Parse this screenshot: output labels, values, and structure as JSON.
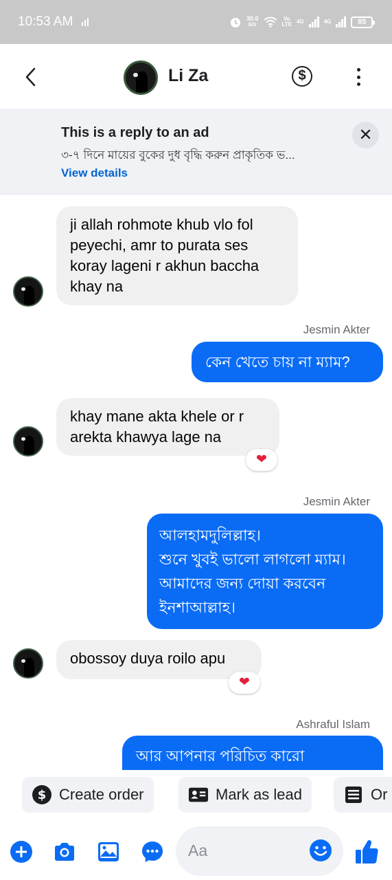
{
  "status_bar": {
    "time": "10:53 AM",
    "speed_value": "30.0",
    "speed_unit": "B/S",
    "volte_top": "Vo",
    "volte_bottom": "LTE",
    "net1": "4G",
    "net2": "4G",
    "battery": "85"
  },
  "header": {
    "contact_name": "Li Za",
    "back_icon": "chevron-left-icon",
    "payment_icon": "dollar-icon",
    "more_icon": "more-vertical-icon"
  },
  "ad_banner": {
    "title": "This is a reply to an ad",
    "description": "৩-৭ দিনে মায়ের বুকের দুধ বৃদ্ধি করুন প্রাকৃতিক ভ...",
    "link_label": "View details",
    "close_label": "✕"
  },
  "messages": [
    {
      "direction": "incoming",
      "text": "ji allah rohmote khub vlo fol peyechi, amr to purata ses koray lageni r akhun baccha khay na"
    },
    {
      "direction": "outgoing",
      "sender": "Jesmin Akter",
      "text": "কেন খেতে চায় না ম্যাম?"
    },
    {
      "direction": "incoming",
      "text": "khay mane akta khele or r arekta khawya lage na",
      "reaction": "❤"
    },
    {
      "direction": "outgoing",
      "sender": "Jesmin Akter",
      "text": "আলহামদুলিল্লাহ।\nশুনে খুবই ভালো লাগলো ম্যাম।\nআমাদের জন্য দোয়া করবেন\nইনশাআল্লাহ।"
    },
    {
      "direction": "incoming",
      "text": "obossoy duya roilo apu",
      "reaction": "❤"
    },
    {
      "direction": "outgoing",
      "sender": "Ashraful Islam",
      "text": "আর আপনার পরিচিত কারো"
    }
  ],
  "quick_actions": [
    {
      "label": "Create order",
      "icon": "dollar-circle-icon"
    },
    {
      "label": "Mark as lead",
      "icon": "contact-card-icon"
    },
    {
      "label": "Or",
      "icon": "order-list-icon"
    }
  ],
  "composer": {
    "placeholder": "Aa",
    "icons": [
      "plus-icon",
      "camera-icon",
      "gallery-icon",
      "chat-bubble-icon",
      "emoji-icon",
      "thumbs-up-icon"
    ]
  },
  "colors": {
    "accent": "#0a6cf5",
    "incoming_bubble": "#f0f0f0",
    "status_bar": "#c8c8c8",
    "banner_bg": "#f0f2f5",
    "reaction_heart": "#e41e3f"
  }
}
